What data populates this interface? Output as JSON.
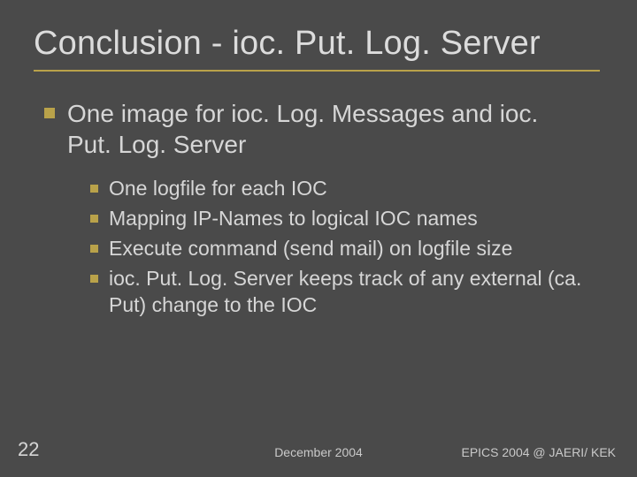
{
  "title": "Conclusion - ioc. Put. Log. Server",
  "lvl1": "One image for ioc. Log. Messages and ioc. Put. Log. Server",
  "lvl2": [
    "One logfile for each IOC",
    "Mapping IP-Names to logical IOC names",
    "Execute command (send mail) on logfile size",
    "ioc. Put. Log. Server keeps track of any external (ca. Put) change to the IOC"
  ],
  "footer": {
    "page": "22",
    "center": "December 2004",
    "right": "EPICS 2004 @ JAERI/ KEK"
  }
}
